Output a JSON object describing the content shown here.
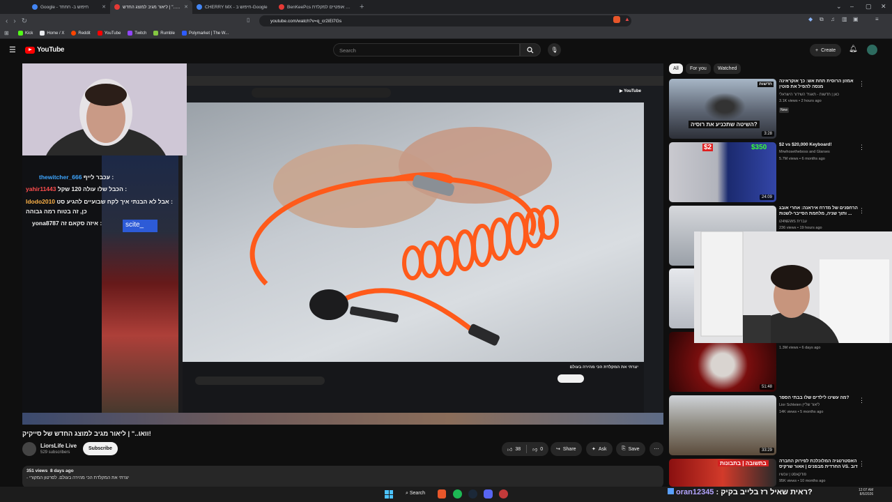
{
  "browser": {
    "tabs": [
      {
        "title": "Google - חיפוש ב- חחחד",
        "active": false
      },
      {
        "title": "וואו..\" | ליאור מגיב למוצג החדש",
        "active": true
      },
      {
        "title": "CHERRY MX - חיפוש ב-Google",
        "active": false
      },
      {
        "title": "BenKeePcs סוויצ'ים אופטיים למקלדת",
        "active": false
      }
    ],
    "new_tab": "+",
    "url": "youtube.com/watch?v=q_cr2iEl7Gs",
    "bookmarks": [
      {
        "label": "Kick",
        "color": "#53fc18"
      },
      {
        "label": "Home / X",
        "color": "#e8eaed"
      },
      {
        "label": "Reddit",
        "color": "#ff4500"
      },
      {
        "label": "YouTube",
        "color": "#ff0000"
      },
      {
        "label": "Twitch",
        "color": "#9146ff"
      },
      {
        "label": "Rumble",
        "color": "#85c742"
      },
      {
        "label": "Polymarket | The W...",
        "color": "#2e5cff"
      }
    ]
  },
  "youtube": {
    "logo": "YouTube",
    "search_placeholder": "Search",
    "create_label": "Create",
    "chips": [
      "All",
      "For you",
      "Watched"
    ]
  },
  "stream_chat": [
    {
      "user": "thewitcher_666",
      "text": "עכבר לייף :",
      "color": "#3ea6ff"
    },
    {
      "user": "yahir11443",
      "text": "הכבל שלו עולה 120 שקל :",
      "color": "#ff4d4d"
    },
    {
      "user": "ldodo2010",
      "text": "אבל לא הבנתי איך לקח שבועיים להגיע סט :",
      "color": "#ffb347"
    },
    {
      "user": "",
      "text": "כן, זה בטוח רמה גבוהה",
      "color": "#ffffff"
    },
    {
      "user": "yona8787",
      "text": "איזה סקאם זה :",
      "color": "#ffffff"
    }
  ],
  "overlay_label": "scite_",
  "video": {
    "inner_title": "יצרתי את המקלדת הכי מהירה בעולם",
    "title": "וואו..\" | ליאור מגיב למוצג החדש של סייקיק!",
    "channel": "LiorsLife Live",
    "subscribers": "529 subscribers",
    "subscribe_label": "Subscribe",
    "likes": "38",
    "dislikes": "0",
    "share_label": "Share",
    "ask_label": "Ask",
    "save_label": "Save",
    "views": "351 views",
    "age": "8 days ago",
    "description": "- יצרתי את המקלדת הכי מהירה בעולם. לסרטון המקורי"
  },
  "recommendations": [
    {
      "title": "אמזון הרוסית תחת אש: כך אוקראינה מנסה להפיל את פוטין",
      "channel": "כאן | חדשות - תאגיד השידור הישראלי",
      "views": "3.1K views",
      "age": "2 hours ago",
      "badge": "New",
      "duration": "3:28",
      "thumb_text": "השיטה שתכניע את רוסיה?",
      "thumb_tag": "חדשות"
    },
    {
      "title": "$2 vs $20,000 Keyboard!",
      "channel": "Mrwhosetheboss and Glarses",
      "views": "5.7M views",
      "age": "6 months ago",
      "duration": "24:09",
      "thumb_left": "$2",
      "thumb_right": "$350"
    },
    {
      "title": "הרחפנים של מדרח איראנה: אחרי אובג ... ותוך שניה, מלחמת הסייבר-לשנות",
      "channel": "i24NEWS עברית",
      "views": "236 views",
      "age": "19 hours ago",
      "duration": ""
    },
    {
      "title": "",
      "channel": "",
      "views": "1.3M views",
      "age": "6 days ago",
      "duration": "51:48"
    },
    {
      "title": "מה עשינו לילדים שלו בבתי הספר?",
      "channel": "Lior Schleien ליאור שליין",
      "views": "14K views",
      "age": "5 months ago",
      "duration": "33:29"
    },
    {
      "title": "האסטרטגיה המלוכלכת לפירוק החברה החרדית מבפנים | אאור שרקיס VS. דוב",
      "channel": "פודקאסט | עכשיו",
      "views": "95K views",
      "age": "10 months ago",
      "duration": "",
      "thumb_text": "בתשובה | בתבונות"
    }
  ],
  "bottom_chat": {
    "user": "oran12345",
    "text": ": ראית שאיל רז בלייב בקיק?"
  },
  "taskbar": {
    "search_label": "Search",
    "time": "12:07 AM",
    "date": "8/5/2026"
  }
}
